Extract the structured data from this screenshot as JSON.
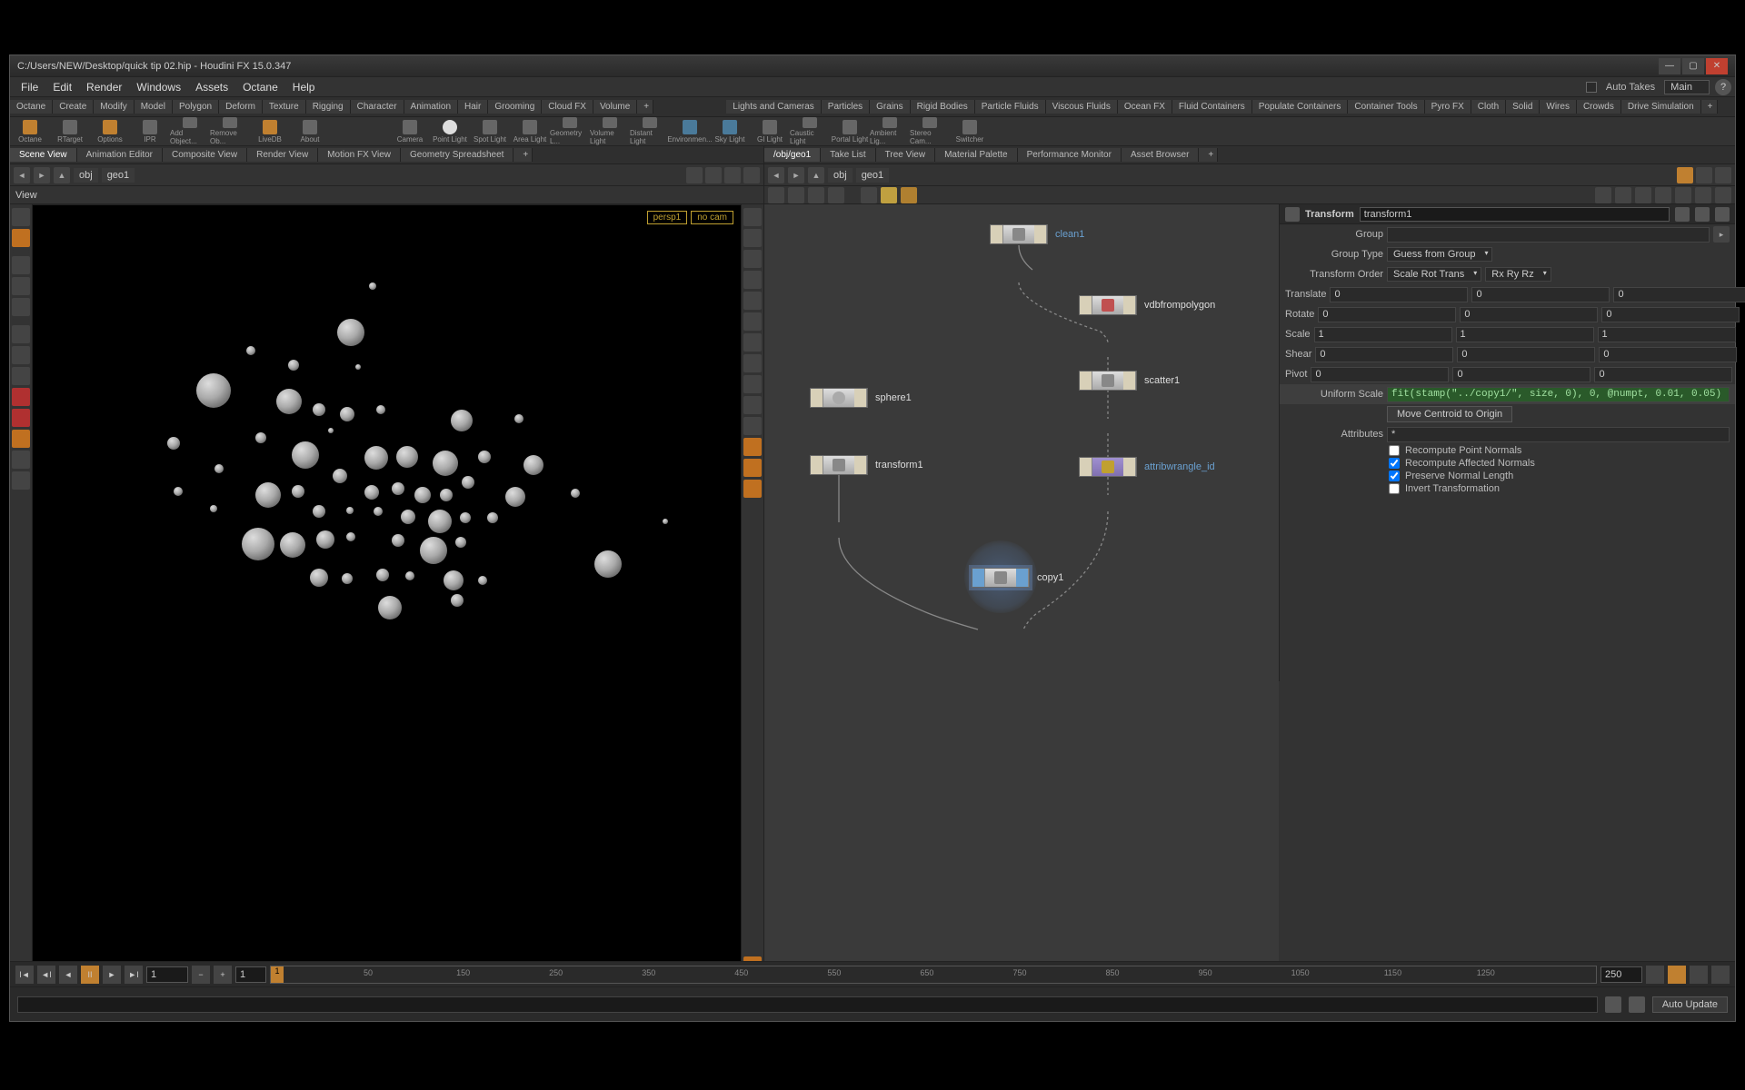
{
  "title": "C:/Users/NEW/Desktop/quick tip 02.hip - Houdini FX 15.0.347",
  "menus": [
    "File",
    "Edit",
    "Render",
    "Windows",
    "Assets",
    "Octane",
    "Help"
  ],
  "autoTakes": "Auto Takes",
  "takeDropdown": "Main",
  "shelfLeft": [
    "Octane",
    "Create",
    "Modify",
    "Model",
    "Polygon",
    "Deform",
    "Texture",
    "Rigging",
    "Character",
    "Animation",
    "Hair",
    "Grooming",
    "Cloud FX",
    "Volume"
  ],
  "shelfRight": [
    "Lights and Cameras",
    "Particles",
    "Grains",
    "Rigid Bodies",
    "Particle Fluids",
    "Viscous Fluids",
    "Ocean FX",
    "Fluid Containers",
    "Populate Containers",
    "Container Tools",
    "Pyro FX",
    "Cloth",
    "Solid",
    "Wires",
    "Crowds",
    "Drive Simulation"
  ],
  "railLeft": [
    "Octane",
    "RTarget",
    "Options",
    "IPR",
    "Add Object...",
    "Remove Ob...",
    "LiveDB",
    "About"
  ],
  "railRight": [
    "Camera",
    "Point Light",
    "Spot Light",
    "Area Light",
    "Geometry L...",
    "Volume Light",
    "Distant Light",
    "Environmen...",
    "Sky Light",
    "GI Light",
    "Caustic Light",
    "Portal Light",
    "Ambient Lig...",
    "Stereo Cam...",
    "Switcher"
  ],
  "tabsLeft": [
    "Scene View",
    "Animation Editor",
    "Composite View",
    "Render View",
    "Motion FX View",
    "Geometry Spreadsheet"
  ],
  "tabsRight": [
    "/obj/geo1",
    "Take List",
    "Tree View",
    "Material Palette",
    "Performance Monitor",
    "Asset Browser"
  ],
  "pathLeft": {
    "scope": "obj",
    "node": "geo1"
  },
  "pathRight": {
    "scope": "obj",
    "node": "geo1"
  },
  "viewLabel": "View",
  "hud": {
    "persp": "persp1",
    "cam": "no cam"
  },
  "nodes": {
    "clean1": "clean1",
    "vdb": "vdbfrompolygon",
    "scatter": "scatter1",
    "sphere": "sphere1",
    "xform": "transform1",
    "wrangle": "attribwrangle_id",
    "copy": "copy1"
  },
  "param": {
    "type": "Transform",
    "name": "transform1",
    "labels": {
      "group": "Group",
      "groupType": "Group Type",
      "xorder": "Transform Order",
      "t": "Translate",
      "r": "Rotate",
      "s": "Scale",
      "sh": "Shear",
      "p": "Pivot",
      "uscale": "Uniform Scale",
      "moveC": "Move Centroid to Origin",
      "attrs": "Attributes",
      "c1": "Recompute Point Normals",
      "c2": "Recompute Affected Normals",
      "c3": "Preserve Normal Length",
      "c4": "Invert Transformation"
    },
    "groupType": "Guess from Group",
    "xorder1": "Scale Rot Trans",
    "xorder2": "Rx Ry Rz",
    "t": [
      "0",
      "0",
      "0"
    ],
    "r": [
      "0",
      "0",
      "0"
    ],
    "s": [
      "1",
      "1",
      "1"
    ],
    "sh": [
      "0",
      "0",
      "0"
    ],
    "p": [
      "0",
      "0",
      "0"
    ],
    "uscale": "fit(stamp(\"../copy1/\", size, 0), 0, @numpt, 0.01, 0.05)",
    "attrs": "*"
  },
  "timeline": {
    "start": "1",
    "end": "250",
    "ticks": [
      "50",
      "150",
      "250",
      "350",
      "450",
      "550",
      "650",
      "750",
      "850",
      "950",
      "1050",
      "1150",
      "1250"
    ],
    "tvals": [
      "50",
      "150",
      "250",
      "350",
      "450",
      "550",
      "650",
      "750",
      "850",
      "950",
      "1050",
      "1150",
      "1250"
    ]
  },
  "status": {
    "auto": "Auto Update"
  }
}
